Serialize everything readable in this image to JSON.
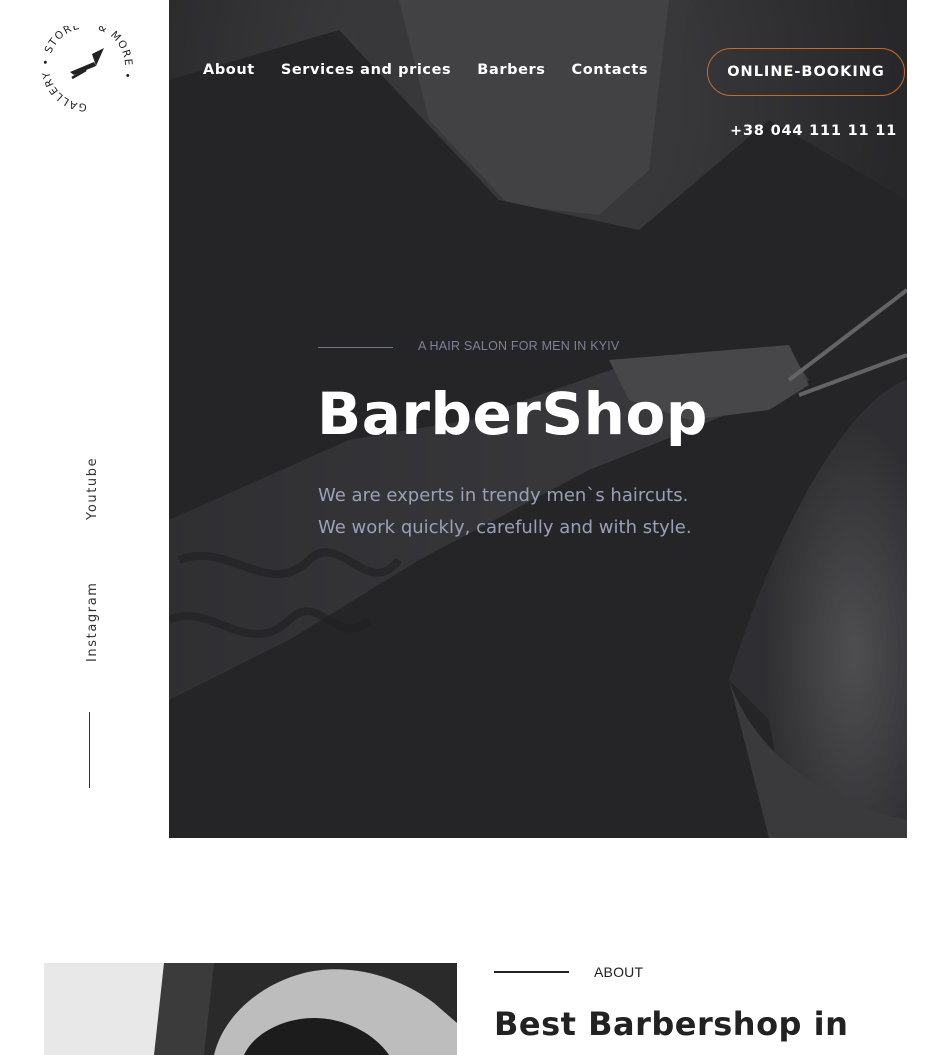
{
  "logo": {
    "icon": "razor-icon",
    "ring_text": "GALLERY • STORE • & MORE •"
  },
  "social": {
    "youtube": "Youtube",
    "instagram": "Instagram"
  },
  "nav": {
    "items": [
      {
        "label": "About"
      },
      {
        "label": "Services and prices"
      },
      {
        "label": "Barbers"
      },
      {
        "label": "Contacts"
      }
    ],
    "booking_label": "ONLINE-BOOKING",
    "phone": "+38 044 111 11 11"
  },
  "hero": {
    "eyebrow": "A HAIR SALON FOR MEN IN KYIV",
    "title": "BarberShop",
    "desc_line1": "We are experts in trendy men`s haircuts.",
    "desc_line2": "We work quickly, carefully and with style."
  },
  "about": {
    "label": "ABOUT",
    "heading": "Best Barbershop in"
  },
  "colors": {
    "accent": "#c46b2a",
    "hero_bg": "#2b2b2d",
    "muted_text": "#9aa0b8"
  }
}
